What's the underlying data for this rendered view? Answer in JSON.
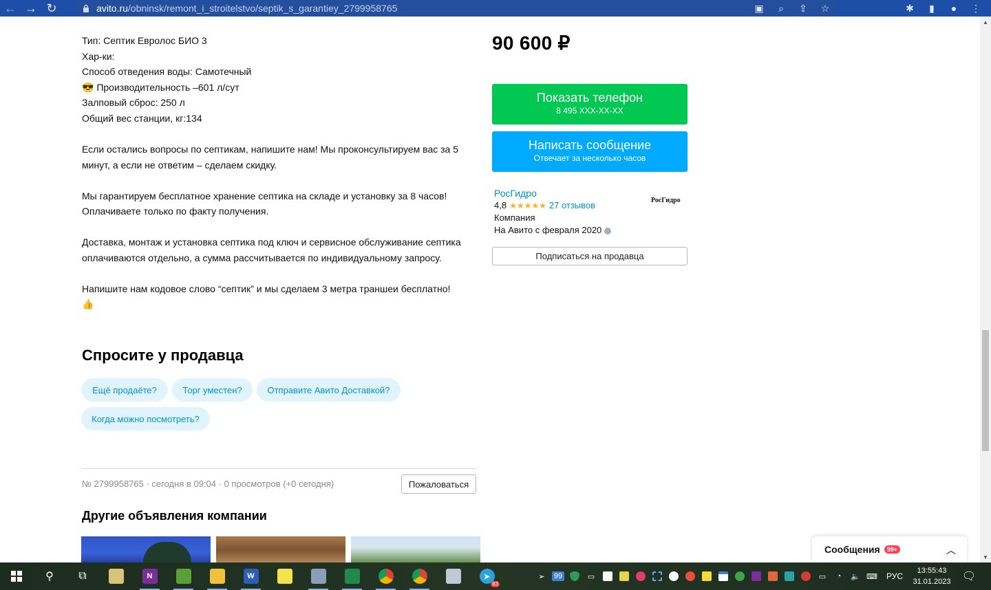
{
  "browser": {
    "url_host": "avito.ru",
    "url_path": "/obninsk/remont_i_stroitelstvo/septik_s_garantiey_2799958765"
  },
  "description": {
    "lines": [
      "Тип: Септик Евролос БИО 3",
      "Хар-ки:",
      "Способ отведения воды: Самотечный",
      "😎 Производительность –601 л/сут",
      "Залповый сброс: 250 л",
      "Общий вес станции, кг:134"
    ],
    "paragraph1": "Если остались вопросы по септикам, напишите нам! Мы проконсультируем вас за 5 минут, а если не ответим – сделаем скидку.",
    "paragraph2": "Мы гарантируем бесплатное хранение септика на складе и установку за 8 часов! Оплачиваете только по факту получения.",
    "paragraph3": "Доставка, монтаж и установка септика под ключ и сервисное обслуживание септика оплачиваются отдельно, а сумма рассчитывается по индивидуальному запросу.",
    "paragraph4": "Напишите нам кодовое слово “септик” и мы сделаем 3 метра траншеи бесплатно!",
    "paragraph4_emoji": "👍"
  },
  "price": "90 600 ₽",
  "phone_button": {
    "label": "Показать телефон",
    "sub": "8 495 XXX-XX-XX",
    "color": "#00c853"
  },
  "message_button": {
    "label": "Написать сообщение",
    "sub": "Отвечает за несколько часов",
    "color": "#00aaff"
  },
  "seller": {
    "name": "РосГидро",
    "rating": "4,8",
    "stars": "★★★★★",
    "reviews": "27 отзывов",
    "type": "Компания",
    "since": "На Авито с февраля 2020",
    "logo_text": "РосГидро"
  },
  "subscribe_label": "Подписаться на продавца",
  "ask": {
    "title": "Спросите у продавца",
    "chips": [
      "Ещё продаёте?",
      "Торг уместен?",
      "Отправите Авито Доставкой?",
      "Когда можно посмотреть?"
    ]
  },
  "meta": "№ 2799958765 · сегодня в 09:04 · 0 просмотров (+0 сегодня)",
  "complain_label": "Пожаловаться",
  "other_title": "Другие объявления компании",
  "messages": {
    "label": "Сообщения",
    "badge": "99+"
  },
  "taskbar": {
    "tray_badge": "99",
    "telegram_badge": "83",
    "language": "РУС",
    "time": "13:55:43",
    "date": "31.01.2023"
  }
}
